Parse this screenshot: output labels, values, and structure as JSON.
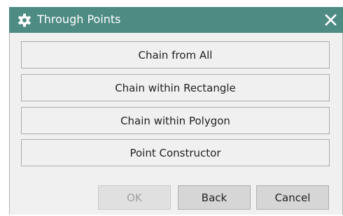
{
  "window": {
    "title": "Through Points",
    "title_icon": "gear-icon",
    "close_icon": "close-icon",
    "titlebar_color": "#4e8b82"
  },
  "options": [
    {
      "label": "Chain from All"
    },
    {
      "label": "Chain within Rectangle"
    },
    {
      "label": "Chain within Polygon"
    },
    {
      "label": "Point Constructor"
    }
  ],
  "footer": {
    "ok_label": "OK",
    "ok_enabled": false,
    "back_label": "Back",
    "cancel_label": "Cancel"
  }
}
